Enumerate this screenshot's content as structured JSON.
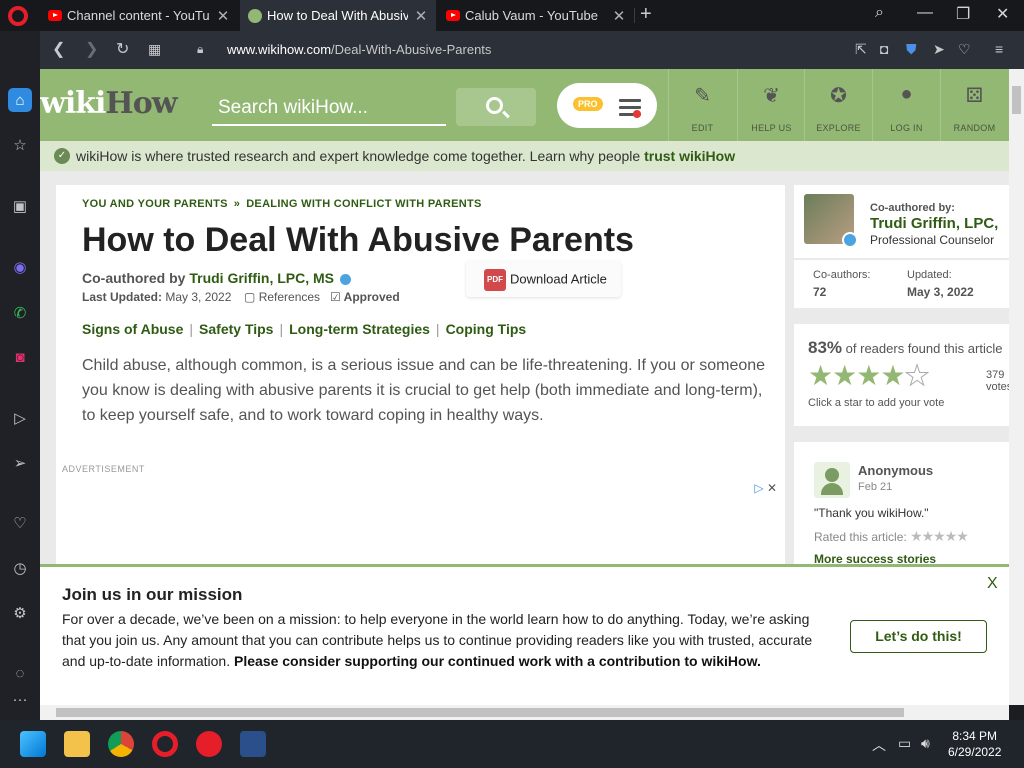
{
  "browser": {
    "tabs": [
      {
        "title": "Channel content - YouTube",
        "active": false
      },
      {
        "title": "How to Deal With Abusive",
        "active": true
      },
      {
        "title": "Calub Vaum - YouTube",
        "active": false
      }
    ],
    "url_domain": "www.wikihow.com",
    "url_path": "/Deal-With-Abusive-Parents"
  },
  "wikihow": {
    "logo_wiki": "wiki",
    "logo_how": "How",
    "search_placeholder": "Search wikiHow...",
    "pro_badge": "PRO",
    "nav": [
      {
        "label": "EDIT",
        "icon": "pencil-icon"
      },
      {
        "label": "HELP US",
        "icon": "sprout-icon"
      },
      {
        "label": "EXPLORE",
        "icon": "compass-icon"
      },
      {
        "label": "LOG IN",
        "icon": "user-icon"
      },
      {
        "label": "RANDOM",
        "icon": "dice-icon"
      }
    ],
    "trust_text": "wikiHow is where trusted research and expert knowledge come together. Learn why people",
    "trust_link": "trust wikiHow"
  },
  "article": {
    "breadcrumb_1": "YOU AND YOUR PARENTS",
    "breadcrumb_sep": "»",
    "breadcrumb_2": "DEALING WITH CONFLICT WITH PARENTS",
    "title": "How to Deal With Abusive Parents",
    "coauthored_label": "Co-authored by",
    "coauthor": "Trudi Griffin, LPC, MS",
    "updated_label": "Last Updated:",
    "updated_date": "May 3, 2022",
    "references": "References",
    "approved": "Approved",
    "download": "Download Article",
    "pdf_label": "PDF",
    "toc": [
      "Signs of Abuse",
      "Safety Tips",
      "Long-term Strategies",
      "Coping Tips"
    ],
    "intro": "Child abuse, although common, is a serious issue and can be life-threatening. If you or someone you know is dealing with abusive parents it is crucial to get help (both immediate and long-term), to keep yourself safe, and to work toward coping in healthy ways.",
    "advertisement": "ADVERTISEMENT"
  },
  "author_card": {
    "coauthored_by": "Co-authored by:",
    "name": "Trudi Griffin, LPC,",
    "profession": "Professional Counselor",
    "coauthors_label": "Co-authors:",
    "coauthors_value": "72",
    "updated_label": "Updated:",
    "updated_value": "May 3, 2022"
  },
  "rating": {
    "percent": "83%",
    "text": "of readers found this article",
    "stars_filled": 4,
    "stars_total": 5,
    "votes": "379 votes",
    "cta": "Click a star to add your vote"
  },
  "success_story": {
    "name": "Anonymous",
    "date": "Feb 21",
    "quote": "\"Thank you wikiHow.\"",
    "rated_label": "Rated this article:",
    "more": "More success stories"
  },
  "mission": {
    "heading": "Join us in our mission",
    "body": "For over a decade, we’ve been on a mission: to help everyone in the world learn how to do anything. Today, we’re asking that you join us. Any amount that you can contribute helps us to continue providing readers like you with trusted, accurate and up-to-date information.",
    "body_bold": "Please consider supporting our continued work with a contribution to wikiHow.",
    "button": "Let’s do this!",
    "close": "X"
  },
  "taskbar": {
    "time": "8:34 PM",
    "date": "6/29/2022"
  },
  "colors": {
    "wikihow_green": "#93b874",
    "link_green": "#2f5b13",
    "opera_red": "#e51e2a"
  }
}
